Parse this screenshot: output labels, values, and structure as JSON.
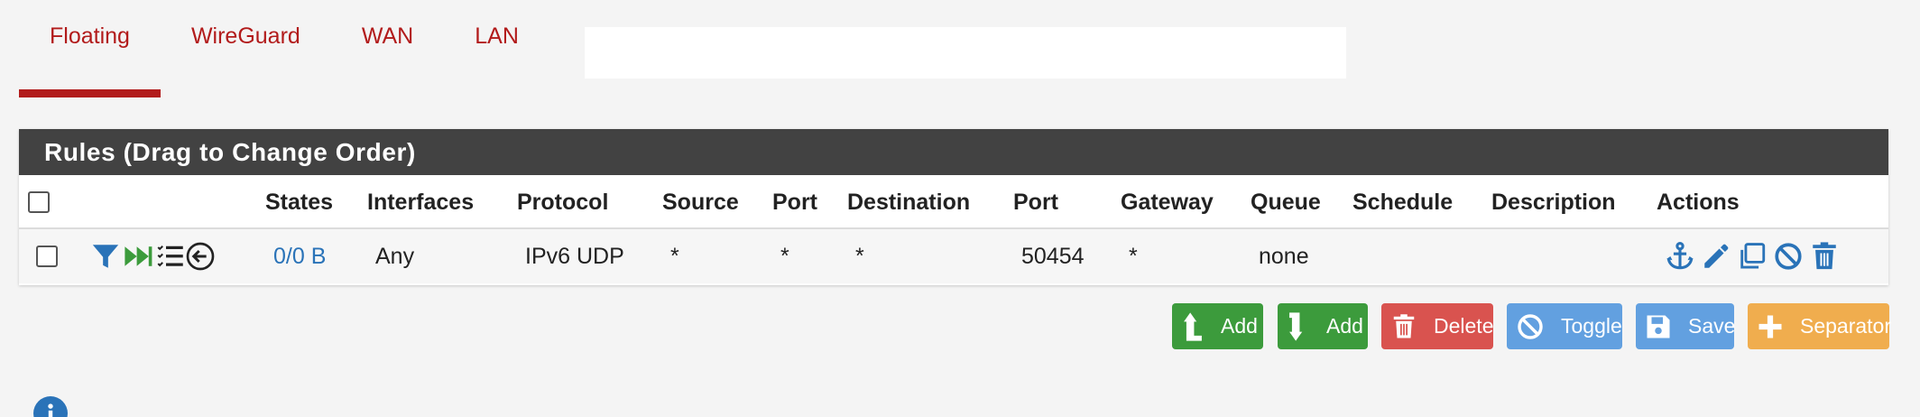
{
  "tabs": [
    {
      "label": "Floating",
      "active": true
    },
    {
      "label": "WireGuard",
      "active": false
    },
    {
      "label": "WAN",
      "active": false
    },
    {
      "label": "LAN",
      "active": false
    }
  ],
  "panel": {
    "title": "Rules (Drag to Change Order)",
    "headers": {
      "states": "States",
      "interfaces": "Interfaces",
      "protocol": "Protocol",
      "source": "Source",
      "source_port": "Port",
      "destination": "Destination",
      "dest_port": "Port",
      "gateway": "Gateway",
      "queue": "Queue",
      "schedule": "Schedule",
      "description": "Description",
      "actions": "Actions"
    },
    "rows": [
      {
        "states": "0/0 B",
        "interfaces": "Any",
        "protocol": "IPv6 UDP",
        "source": "*",
        "source_port": "*",
        "destination": "*",
        "dest_port": "50454",
        "gateway": "*",
        "queue": "none",
        "schedule": "",
        "description": "",
        "icons": [
          "filter-icon",
          "fast-forward-icon",
          "list-icon",
          "direction-in-icon"
        ],
        "action_icons": [
          "anchor-icon",
          "edit-icon",
          "copy-icon",
          "disable-icon",
          "trash-icon"
        ]
      }
    ]
  },
  "buttons": {
    "add_top": "Add",
    "add_bottom": "Add",
    "delete": "Delete",
    "toggle": "Toggle",
    "save": "Save",
    "separator": "Separator"
  },
  "colors": {
    "tab_accent": "#b21b1b",
    "panel_heading": "#424242",
    "link_blue": "#2a73b8",
    "button_green": "#3c9b3c",
    "button_red": "#d9534f",
    "button_blue": "#62a0e0",
    "button_orange": "#f0ad4e"
  }
}
